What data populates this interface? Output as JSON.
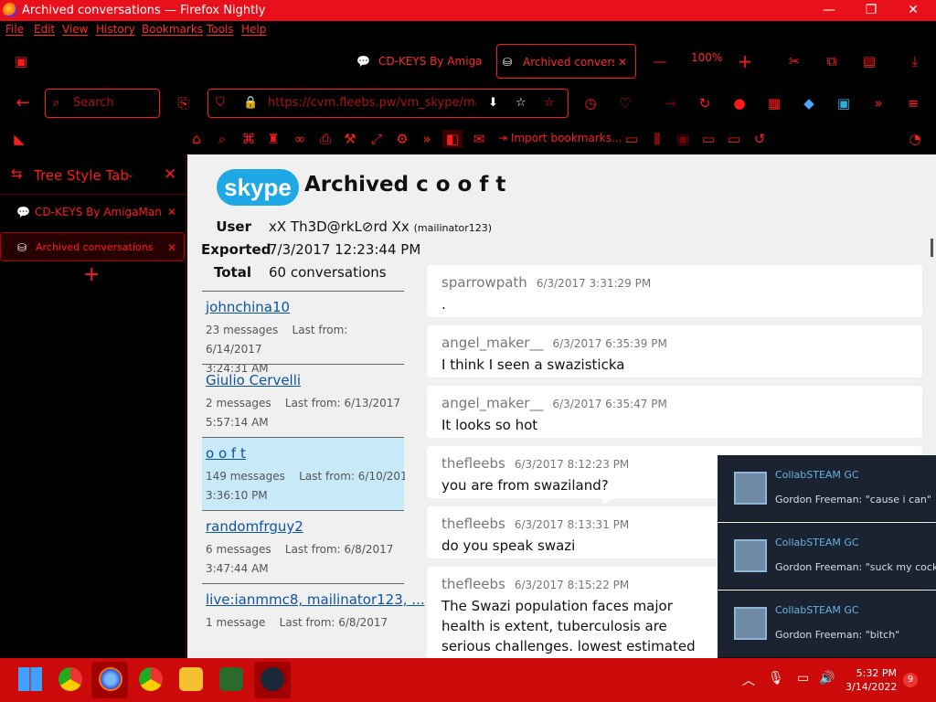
{
  "window": {
    "title": "Archived conversations — Firefox Nightly",
    "minimize": "—",
    "maximize": "❐",
    "close": "✕"
  },
  "menu": [
    "File",
    "Edit",
    "View",
    "History",
    "Bookmarks",
    "Tools",
    "Help"
  ],
  "tabs": [
    {
      "label": "CD-KEYS By Amiga"
    },
    {
      "label": "Archived convers"
    }
  ],
  "toolbar": {
    "zoom": "100%"
  },
  "nav": {
    "search_placeholder": "Search",
    "url": "https://cvm.fleebs.pw/vm_skype/mail"
  },
  "bookmarks": {
    "import_label": "Import bookmarks..."
  },
  "sidebar": {
    "title": "Tree Style Tab",
    "items": [
      {
        "label": "CD-KEYS By AmigaMan"
      },
      {
        "label": "Archived conversations"
      }
    ],
    "add": "+"
  },
  "page": {
    "logo_text": "skype",
    "heading": "Archived c o o f t",
    "user_label": "User",
    "user_value": "xX Th3D@rkL⊘rd Xx",
    "user_sub": "(mailinator123)",
    "exported_label": "Exported",
    "exported_value": "7/3/2017 12:23:44 PM",
    "total_label": "Total",
    "total_value": "60 conversations"
  },
  "conversations": [
    {
      "name": "johnchina10",
      "count": "23 messages",
      "last": "Last from: 6/14/2017",
      "time": "3:24:31 AM"
    },
    {
      "name": "Giulio Cervelli",
      "count": "2 messages",
      "last": "Last from: 6/13/2017",
      "time": "5:57:14 AM"
    },
    {
      "name": "o o f t",
      "count": "149 messages",
      "last": "Last from: 6/10/2017",
      "time": "3:36:10 PM"
    },
    {
      "name": "randomfrguy2",
      "count": "6 messages",
      "last": "Last from: 6/8/2017",
      "time": "3:47:44 AM"
    },
    {
      "name": "live:ianmmc8, mailinator123, ...",
      "count": "1 message",
      "last": "Last from: 6/8/2017",
      "time": ""
    }
  ],
  "messages": [
    {
      "author": "sparrowpath",
      "time": "6/3/2017 3:31:29 PM",
      "text": "."
    },
    {
      "author": "angel_maker__",
      "time": "6/3/2017 6:35:39 PM",
      "text": "I think I seen a swazisticka"
    },
    {
      "author": "angel_maker__",
      "time": "6/3/2017 6:35:47 PM",
      "text": "It looks so hot"
    },
    {
      "author": "thefleebs",
      "time": "6/3/2017 8:12:23 PM",
      "text": "you are from swaziland?"
    },
    {
      "author": "thefleebs",
      "time": "6/3/2017 8:13:31 PM",
      "text": "do you speak swazi"
    },
    {
      "author": "thefleebs",
      "time": "6/3/2017 8:15:22 PM",
      "text": "The Swazi population faces major health is extent, tuberculosis are serious challenges. lowest estimated life expectancy in the wor"
    }
  ],
  "notifications": [
    {
      "group": "CollabSTEAM GC",
      "text": "Gordon Freeman: \"cause i can\""
    },
    {
      "group": "CollabSTEAM GC",
      "text": "Gordon Freeman: \"suck my cock\""
    },
    {
      "group": "CollabSTEAM GC",
      "text": "Gordon Freeman: \"bitch\""
    }
  ],
  "taskbar": {
    "time": "5:32 PM",
    "date": "3/14/2022",
    "badge": "9"
  }
}
